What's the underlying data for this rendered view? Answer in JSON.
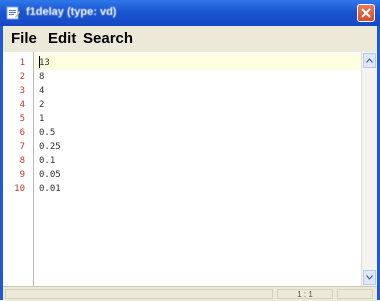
{
  "window": {
    "title": "f1delay  (type: vd)",
    "app_icon": "document-edit-icon",
    "close_icon": "close-icon",
    "colors": {
      "titlebar": "#1a55d0",
      "close_button": "#d34d27",
      "line_numbers": "#c0392b",
      "current_line": "#fdfde0"
    }
  },
  "menu": {
    "file": "File",
    "edit": "Edit",
    "search": "Search"
  },
  "editor": {
    "line_numbers": [
      "1",
      "2",
      "3",
      "4",
      "5",
      "6",
      "7",
      "8",
      "9",
      "10"
    ],
    "lines": [
      "13",
      "8",
      "4",
      "2",
      "1",
      "0.5",
      "0.25",
      "0.1",
      "0.05",
      "0.01"
    ],
    "caret_line": 1
  },
  "scrollbar": {
    "up_icon": "scroll-up-arrow-icon",
    "down_icon": "scroll-down-arrow-icon"
  },
  "status": {
    "position": "1 : 1"
  }
}
